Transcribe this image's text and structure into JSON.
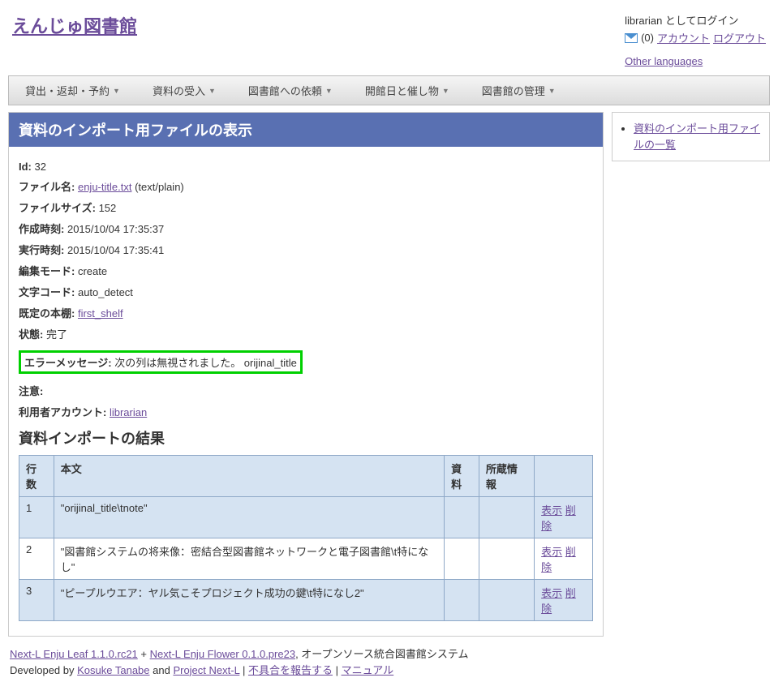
{
  "site_title": "えんじゅ図書館",
  "user": {
    "logged_in_as": "librarian としてログイン",
    "count": "(0)",
    "account_link": "アカウント",
    "logout_link": "ログアウト",
    "other_languages": "Other languages"
  },
  "nav": {
    "loan": "貸出・返却・予約",
    "acquire": "資料の受入",
    "request": "図書館への依頼",
    "calendar": "開館日と催し物",
    "manage": "図書館の管理"
  },
  "page": {
    "title": "資料のインポート用ファイルの表示",
    "fields": {
      "id_label": "Id:",
      "id_value": "32",
      "filename_label": "ファイル名:",
      "filename_link": "enju-title.txt",
      "filename_mime": " (text/plain)",
      "filesize_label": "ファイルサイズ:",
      "filesize_value": "152",
      "created_label": "作成時刻:",
      "created_value": "2015/10/04 17:35:37",
      "executed_label": "実行時刻:",
      "executed_value": "2015/10/04 17:35:41",
      "mode_label": "編集モード:",
      "mode_value": "create",
      "encoding_label": "文字コード:",
      "encoding_value": "auto_detect",
      "shelf_label": "既定の本棚:",
      "shelf_link": "first_shelf",
      "state_label": "状態:",
      "state_value": "完了",
      "error_label": "エラーメッセージ:",
      "error_value": "次の列は無視されました。 orijinal_title",
      "note_label": "注意:",
      "note_value": "",
      "account_label": "利用者アカウント:",
      "account_link": "librarian"
    },
    "results_title": "資料インポートの結果",
    "table": {
      "headers": {
        "line": "行数",
        "body": "本文",
        "resource": "資料",
        "item": "所蔵情報",
        "actions": ""
      },
      "rows": [
        {
          "line": "1",
          "body": "\"orijinal_title\\tnote\"",
          "show": "表示",
          "delete": "削除"
        },
        {
          "line": "2",
          "body": "\"図書館システムの将来像：密結合型図書館ネットワークと電子図書館\\t特になし\"",
          "show": "表示",
          "delete": "削除"
        },
        {
          "line": "3",
          "body": "\"ピープルウエア：ヤル気こそプロジェクト成功の鍵\\t特になし2\"",
          "show": "表示",
          "delete": "削除"
        }
      ]
    }
  },
  "sidebar": {
    "list_link": "資料のインポート用ファイルの一覧"
  },
  "footer": {
    "leaf": "Next-L Enju Leaf 1.1.0.rc21",
    "plus": " + ",
    "flower": "Next-L Enju Flower 0.1.0.pre23",
    "suffix": ", オープンソース統合図書館システム",
    "developed": "Developed by ",
    "author": "Kosuke Tanabe",
    "and": " and ",
    "project": "Project Next-L",
    "sep": " | ",
    "report": "不具合を報告する",
    "manual": "マニュアル"
  }
}
